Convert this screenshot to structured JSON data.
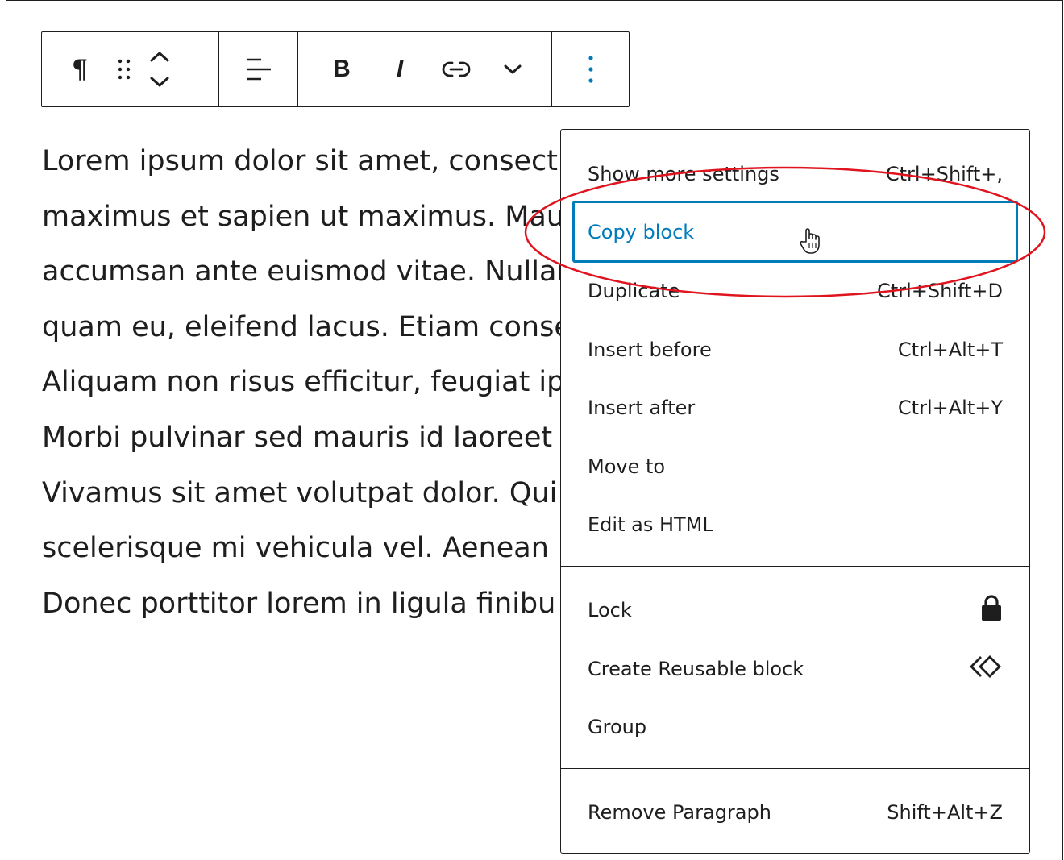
{
  "toolbar": {
    "block_type_icon": "paragraph-icon",
    "drag_icon": "drag-handle-icon",
    "move_icon": "chevron-up-down-icon",
    "align_icon": "align-left-icon",
    "bold_label": "B",
    "italic_label": "I",
    "link_icon": "link-icon",
    "more_icon": "chevron-down-icon",
    "options_icon": "more-vertical-icon",
    "pilcrow": "¶"
  },
  "paragraph": {
    "lines": [
      "Lorem ipsum dolor sit amet, consect",
      "maximus et sapien ut maximus. Mau",
      "accumsan ante euismod vitae. Nullar",
      "quam eu, eleifend lacus. Etiam conse",
      "Aliquam non risus efficitur, feugiat ip",
      "Morbi pulvinar sed mauris id laoreet",
      "Vivamus sit amet volutpat dolor. Qui",
      "scelerisque mi vehicula vel. Aenean p",
      "Donec porttitor lorem in ligula finibu"
    ]
  },
  "menu": {
    "group1": [
      {
        "label": "Show more settings",
        "shortcut": "Ctrl+Shift+,"
      },
      {
        "label": "Copy block",
        "shortcut": ""
      },
      {
        "label": "Duplicate",
        "shortcut": "Ctrl+Shift+D"
      },
      {
        "label": "Insert before",
        "shortcut": "Ctrl+Alt+T"
      },
      {
        "label": "Insert after",
        "shortcut": "Ctrl+Alt+Y"
      },
      {
        "label": "Move to",
        "shortcut": ""
      },
      {
        "label": "Edit as HTML",
        "shortcut": ""
      }
    ],
    "group2": [
      {
        "label": "Lock",
        "icon": "lock-icon"
      },
      {
        "label": "Create Reusable block",
        "icon": "reusable-block-icon"
      },
      {
        "label": "Group",
        "icon": ""
      }
    ],
    "group3": [
      {
        "label": "Remove Paragraph",
        "shortcut": "Shift+Alt+Z"
      }
    ]
  },
  "colors": {
    "accent": "#007cba",
    "annotation": "#e0141e",
    "text": "#1e1e1e"
  }
}
